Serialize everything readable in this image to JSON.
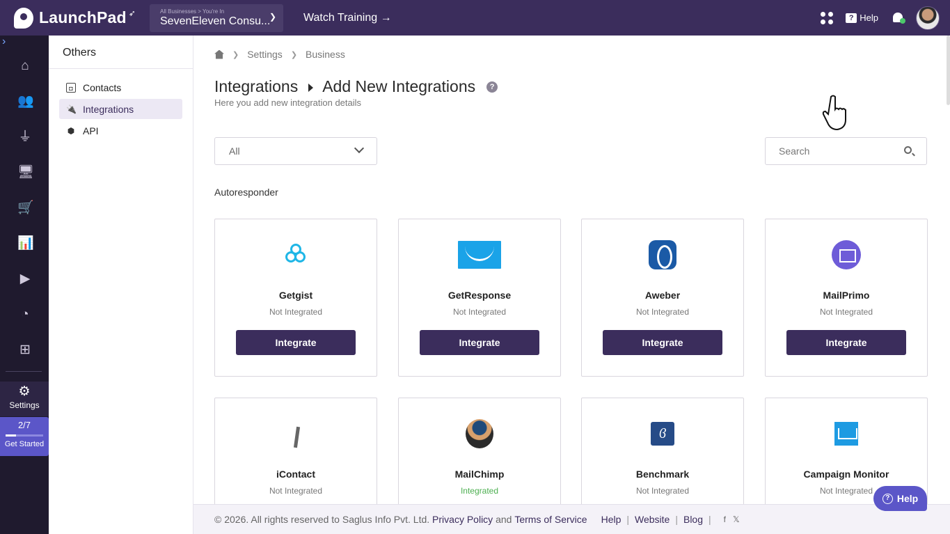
{
  "topbar": {
    "brand": "LaunchPad",
    "business_label": "All Businesses > You're In",
    "business_name": "SevenEleven Consu...",
    "watch_training": "Watch Training →",
    "help_label": "Help"
  },
  "leftnav": {
    "settings_label": "Settings",
    "getstarted_count": "2/7",
    "getstarted_progress": 0.2857,
    "getstarted_label": "Get Started"
  },
  "subnav": {
    "title": "Others",
    "items": [
      {
        "label": "Contacts"
      },
      {
        "label": "Integrations"
      },
      {
        "label": "API"
      }
    ]
  },
  "breadcrumb": {
    "items": [
      "Settings",
      "Business"
    ]
  },
  "page": {
    "title": "Integrations",
    "title_sub": "Add New Integrations",
    "subtitle": "Here you add new integration details",
    "filter_value": "All",
    "search_placeholder": "Search",
    "section": "Autoresponder"
  },
  "cards": [
    {
      "name": "Getgist",
      "status": "Not Integrated",
      "button": "Integrate"
    },
    {
      "name": "GetResponse",
      "status": "Not Integrated",
      "button": "Integrate"
    },
    {
      "name": "Aweber",
      "status": "Not Integrated",
      "button": "Integrate"
    },
    {
      "name": "MailPrimo",
      "status": "Not Integrated",
      "button": "Integrate"
    },
    {
      "name": "iContact",
      "status": "Not Integrated"
    },
    {
      "name": "MailChimp",
      "status": "Integrated"
    },
    {
      "name": "Benchmark",
      "status": "Not Integrated"
    },
    {
      "name": "Campaign Monitor",
      "status": "Not Integrated"
    }
  ],
  "footer": {
    "copyright": "©  2026. All rights reserved to Saglus Info Pvt. Ltd.",
    "privacy": "Privacy Policy",
    "and": "and",
    "terms": "Terms of Service",
    "help": "Help",
    "website": "Website",
    "blog": "Blog",
    "sep": "|"
  },
  "help_float": "Help",
  "colors": {
    "topbar": "#3b2d5c",
    "nav": "#1f1a2e",
    "accent": "#5b56c8",
    "integrated": "#4caf50"
  }
}
